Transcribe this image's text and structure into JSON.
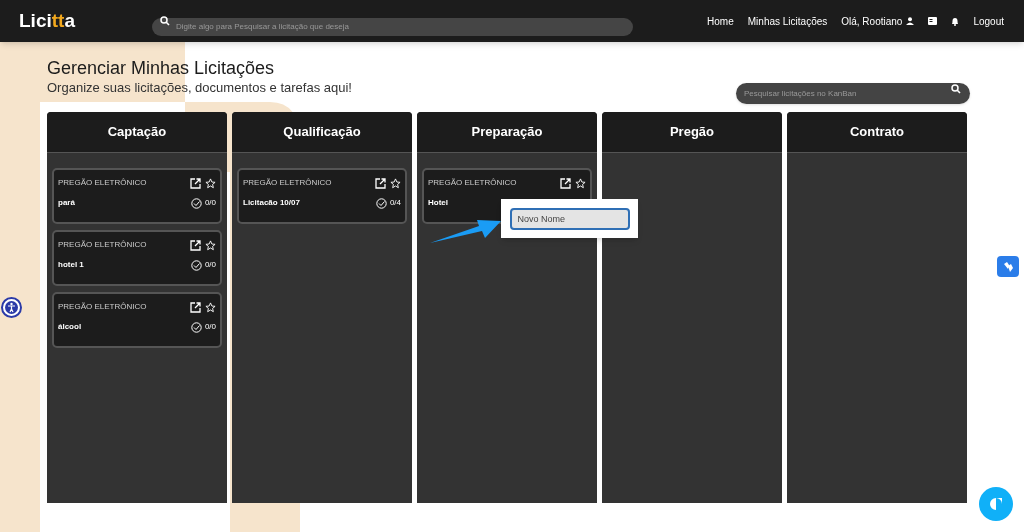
{
  "header": {
    "logo": "Licitta",
    "search_placeholder": "Digite algo para Pesquisar a licitação que deseja",
    "nav": [
      "Home",
      "Minhas Licitações"
    ],
    "user": "Olá, Rootiano",
    "logout": "Logout"
  },
  "page": {
    "title": "Gerenciar Minhas Licitações",
    "subtitle": "Organize suas licitações, documentos e tarefas aqui!",
    "kanban_search_placeholder": "Pesquisar licitações no KanBan"
  },
  "columns": [
    {
      "title": "Captação",
      "cards": [
        {
          "type": "PREGÃO ELETRÔNICO",
          "name": "pará",
          "tasks": "0/0"
        },
        {
          "type": "PREGÃO ELETRÔNICO",
          "name": "hotel 1",
          "tasks": "0/0"
        },
        {
          "type": "PREGÃO ELETRÔNICO",
          "name": "álcool",
          "tasks": "0/0"
        }
      ]
    },
    {
      "title": "Qualificação",
      "cards": [
        {
          "type": "PREGÃO ELETRÔNICO",
          "name": "Licitacão 10/07",
          "tasks": "0/4"
        }
      ]
    },
    {
      "title": "Preparação",
      "cards": [
        {
          "type": "PREGÃO ELETRÔNICO",
          "name": "Hotel"
        }
      ]
    },
    {
      "title": "Pregão"
    },
    {
      "title": "Contrato"
    }
  ],
  "rename_popup": {
    "value": "Novo Nome"
  }
}
